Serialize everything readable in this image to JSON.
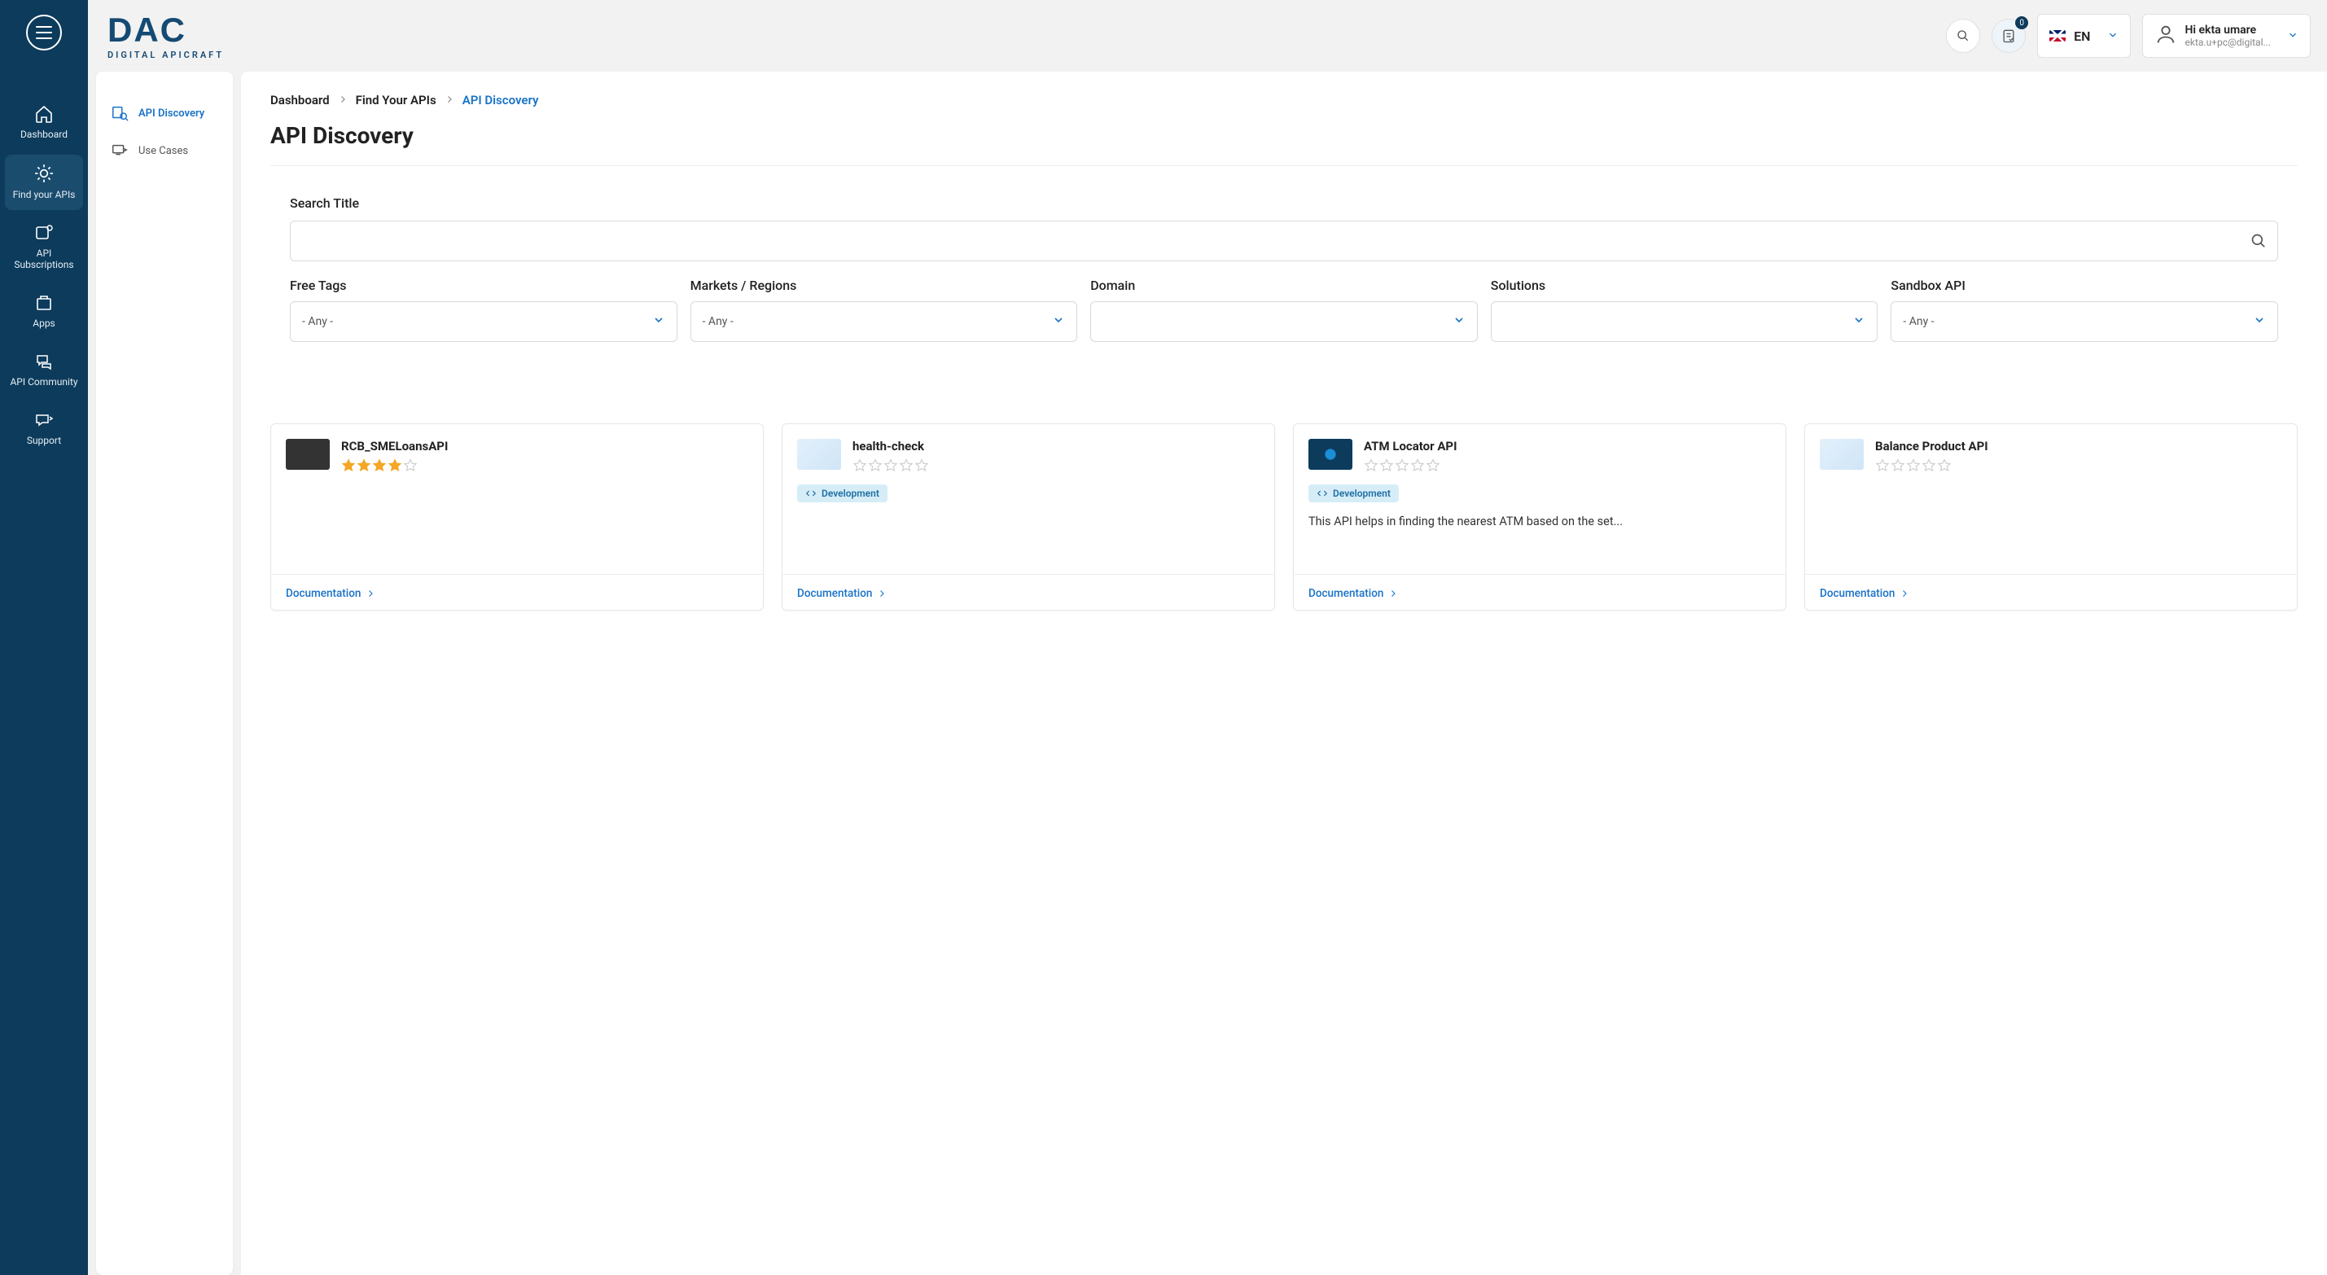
{
  "brand": {
    "name": "DAC",
    "tagline": "DIGITAL APICRAFT"
  },
  "rail": {
    "items": [
      {
        "label": "Dashboard"
      },
      {
        "label": "Find your APIs"
      },
      {
        "label": "API Subscriptions"
      },
      {
        "label": "Apps"
      },
      {
        "label": "API Community"
      },
      {
        "label": "Support"
      }
    ]
  },
  "header": {
    "notif_count": "0",
    "lang_label": "EN",
    "user_greeting": "Hi ekta umare",
    "user_email": "ekta.u+pc@digital..."
  },
  "sidebar": {
    "items": [
      {
        "label": "API Discovery"
      },
      {
        "label": "Use Cases"
      }
    ]
  },
  "breadcrumbs": {
    "a": "Dashboard",
    "b": "Find Your APIs",
    "c": "API Discovery"
  },
  "page_title": "API Discovery",
  "filters": {
    "search_label": "Search Title",
    "search_value": "",
    "cols": [
      {
        "label": "Free Tags",
        "value": "- Any -"
      },
      {
        "label": "Markets / Regions",
        "value": "- Any -"
      },
      {
        "label": "Domain",
        "value": ""
      },
      {
        "label": "Solutions",
        "value": ""
      },
      {
        "label": "Sandbox API",
        "value": "- Any -"
      }
    ]
  },
  "cards": [
    {
      "title": "RCB_SMELoansAPI",
      "rating": 4,
      "tag": "",
      "desc": "",
      "doc": "Documentation",
      "thumb": "dark"
    },
    {
      "title": "health-check",
      "rating": 0,
      "tag": "Development",
      "desc": "",
      "doc": "Documentation",
      "thumb": "light"
    },
    {
      "title": "ATM Locator API",
      "rating": 0,
      "tag": "Development",
      "desc": "This API helps in finding the nearest ATM based on the set...",
      "doc": "Documentation",
      "thumb": "radial"
    },
    {
      "title": "Balance Product API",
      "rating": 0,
      "tag": "",
      "desc": "",
      "doc": "Documentation",
      "thumb": "light"
    }
  ]
}
